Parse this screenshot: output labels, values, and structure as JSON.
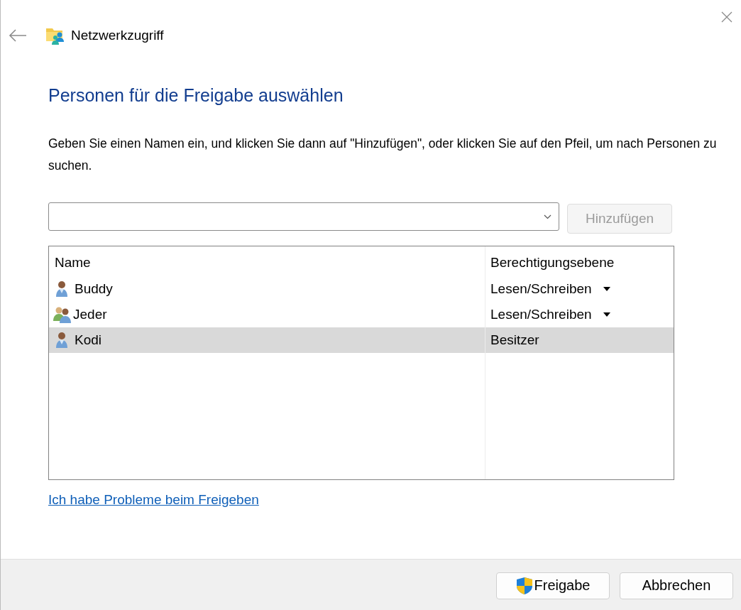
{
  "window": {
    "title": "Netzwerkzugriff"
  },
  "heading": "Personen für die Freigabe auswählen",
  "instructions": "Geben Sie einen Namen ein, und klicken Sie dann auf \"Hinzufügen\", oder klicken Sie auf den Pfeil, um nach Personen zu suchen.",
  "name_field": {
    "add_button": {
      "label": "Hinzufügen",
      "disabled": true
    }
  },
  "table": {
    "columns": [
      "Name",
      "Berechtigungsebene"
    ],
    "rows": [
      {
        "kind": "user",
        "name": "Buddy",
        "permission": "Lesen/Schreiben",
        "dropdown": true,
        "selected": false
      },
      {
        "kind": "group",
        "name": "Jeder",
        "permission": "Lesen/Schreiben",
        "dropdown": true,
        "selected": false
      },
      {
        "kind": "user",
        "name": "Kodi",
        "permission": "Besitzer",
        "dropdown": false,
        "selected": true
      }
    ]
  },
  "help_link": "Ich habe Probleme beim Freigeben",
  "buttons": [
    {
      "kind": "shield",
      "label": "Freigabe"
    },
    {
      "kind": "plain",
      "label": "Abbrechen"
    }
  ]
}
